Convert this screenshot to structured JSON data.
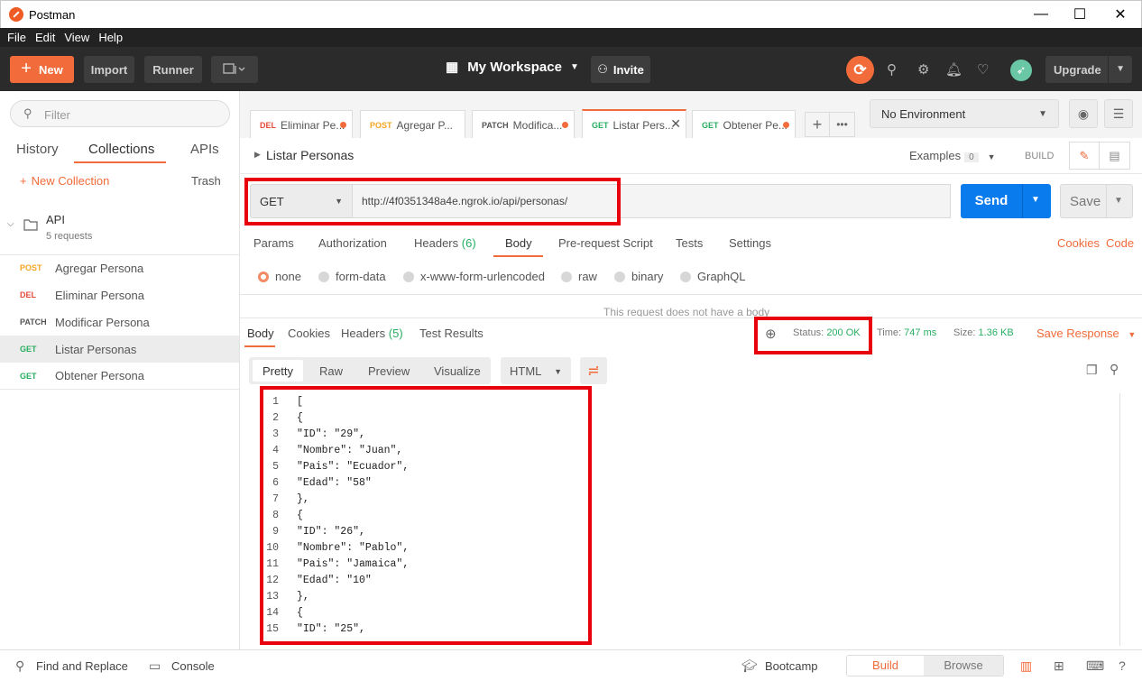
{
  "window": {
    "title": "Postman",
    "controls": {
      "minimize": "—",
      "maximize": "☐",
      "close": "✕"
    }
  },
  "menu": [
    "File",
    "Edit",
    "View",
    "Help"
  ],
  "header": {
    "new_label": "New",
    "import_label": "Import",
    "runner_label": "Runner",
    "workspace_label": "My Workspace",
    "invite_label": "Invite",
    "upgrade_label": "Upgrade"
  },
  "sidebar": {
    "filter_placeholder": "Filter",
    "tabs": [
      "History",
      "Collections",
      "APIs"
    ],
    "active_tab": "Collections",
    "new_collection_label": "New Collection",
    "trash_label": "Trash",
    "collection": {
      "name": "API",
      "count": "5 requests"
    },
    "requests": [
      {
        "method": "POST",
        "name": "Agregar Persona",
        "color": "#f5a623"
      },
      {
        "method": "DEL",
        "name": "Eliminar Persona",
        "color": "#e74c3c"
      },
      {
        "method": "PATCH",
        "name": "Modificar Persona",
        "color": "#555555"
      },
      {
        "method": "GET",
        "name": "Listar Personas",
        "color": "#27ae60"
      },
      {
        "method": "GET",
        "name": "Obtener Persona",
        "color": "#27ae60"
      }
    ]
  },
  "tabs": [
    {
      "method": "DEL",
      "title": "Eliminar Pe...",
      "color": "#e74c3c"
    },
    {
      "method": "POST",
      "title": "Agregar P...",
      "color": "#f5a623"
    },
    {
      "method": "PATCH",
      "title": "Modifica...",
      "color": "#555555"
    },
    {
      "method": "GET",
      "title": "Listar Pers...",
      "color": "#27ae60"
    },
    {
      "method": "GET",
      "title": "Obtener Pe...",
      "color": "#27ae60"
    }
  ],
  "environment": {
    "selected": "No Environment"
  },
  "request": {
    "name": "Listar Personas",
    "examples_label": "Examples",
    "examples_count": "0",
    "build_label": "BUILD",
    "method": "GET",
    "url": "http://4f0351348a4e.ngrok.io/api/personas/",
    "send_label": "Send",
    "save_label": "Save",
    "subtabs": [
      {
        "label": "Params"
      },
      {
        "label": "Authorization"
      },
      {
        "label": "Headers",
        "count": "(6)"
      },
      {
        "label": "Body"
      },
      {
        "label": "Pre-request Script"
      },
      {
        "label": "Tests"
      },
      {
        "label": "Settings"
      }
    ],
    "cookies_label": "Cookies",
    "code_label": "Code",
    "body_types": [
      "none",
      "form-data",
      "x-www-form-urlencoded",
      "raw",
      "binary",
      "GraphQL"
    ],
    "no_body_text": "This request does not have a body"
  },
  "response": {
    "tabs": [
      {
        "label": "Body"
      },
      {
        "label": "Cookies"
      },
      {
        "label": "Headers",
        "count": "(5)"
      },
      {
        "label": "Test Results"
      }
    ],
    "status_label": "Status:",
    "status_value": "200 OK",
    "time_label": "Time:",
    "time_value": "747 ms",
    "size_label": "Size:",
    "size_value": "1.36 KB",
    "save_response_label": "Save Response",
    "view_modes": [
      "Pretty",
      "Raw",
      "Preview",
      "Visualize"
    ],
    "format": "HTML",
    "lines": [
      "[",
      "{",
      "\"ID\": \"29\",",
      "\"Nombre\": \"Juan\",",
      "\"Pais\": \"Ecuador\",",
      "\"Edad\": \"58\"",
      "},",
      "{",
      "\"ID\": \"26\",",
      "\"Nombre\": \"Pablo\",",
      "\"Pais\": \"Jamaica\",",
      "\"Edad\": \"10\"",
      "},",
      "{",
      "\"ID\": \"25\","
    ]
  },
  "footer": {
    "find_replace_label": "Find and Replace",
    "console_label": "Console",
    "bootcamp_label": "Bootcamp",
    "build_label": "Build",
    "browse_label": "Browse"
  },
  "colors": {
    "accent": "#f26b3a",
    "send": "#097bed",
    "highlight": "#e8000c",
    "success": "#27ae60"
  }
}
